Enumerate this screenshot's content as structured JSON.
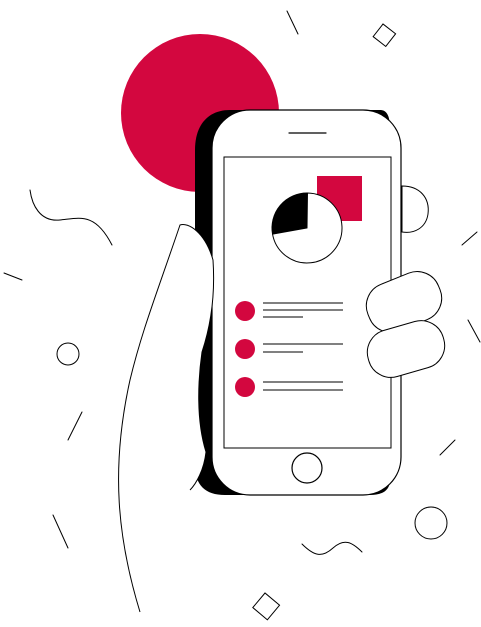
{
  "illustration": {
    "subject": "hand-holding-smartphone",
    "colors": {
      "accent": "#D3073F",
      "ink": "#000000",
      "paper": "#FFFFFF"
    },
    "screen": {
      "pie_chart": {
        "slices": [
          {
            "fraction": 0.28,
            "fill": "#000000"
          },
          {
            "fraction": 0.72,
            "fill": "#FFFFFF"
          }
        ]
      },
      "list_item_count": 3
    }
  }
}
